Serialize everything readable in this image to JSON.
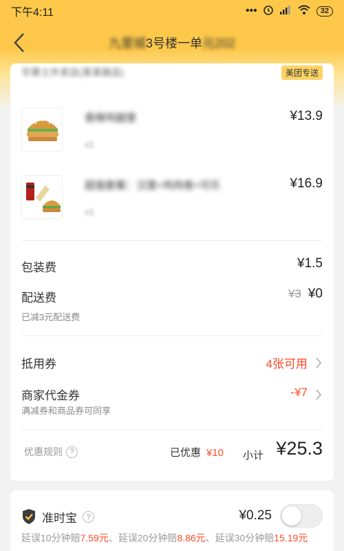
{
  "status_bar": {
    "time": "下午4:11",
    "battery": "32"
  },
  "nav": {
    "title_prefix": "九里城",
    "title_main": "3号楼一单",
    "title_suffix": "元202"
  },
  "store": {
    "name": "华莱士外卖店(某某路店)",
    "delivery_badge": "美团专送"
  },
  "items": [
    {
      "name": "香辣鸡腿堡",
      "qty": "x1",
      "price": "¥13.9",
      "icon": "burger-icon"
    },
    {
      "name": "超值套餐：汉堡+鸡肉卷+可乐",
      "qty": "x1",
      "price": "¥16.9",
      "icon": "combo-meal-icon"
    }
  ],
  "fees": {
    "packing_label": "包装费",
    "packing_value": "¥1.5",
    "delivery_label": "配送费",
    "delivery_original": "¥3",
    "delivery_value": "¥0",
    "delivery_note": "已减3元配送费"
  },
  "coupons": {
    "voucher_label": "抵用券",
    "voucher_value": "4张可用",
    "merchant_label": "商家代金券",
    "merchant_value": "-¥7",
    "merchant_note": "满减券和商品券可同享"
  },
  "summary": {
    "rule_label": "优惠规则",
    "discount_label": "已优惠",
    "discount_value": "¥10",
    "subtotal_label": "小计",
    "subtotal_value": "¥25.3"
  },
  "insurance": {
    "label": "准时宝",
    "price": "¥0.25",
    "enabled": false,
    "desc_1": "延误10分钟赔",
    "amt_1": "7.59元",
    "desc_2": "、延误20分钟赔",
    "amt_2": "8.86元",
    "desc_3": "、延误30分钟赔",
    "amt_3": "15.19元"
  },
  "colors": {
    "brand_yellow": "#fdc84a",
    "accent_red": "#ff4a26"
  }
}
